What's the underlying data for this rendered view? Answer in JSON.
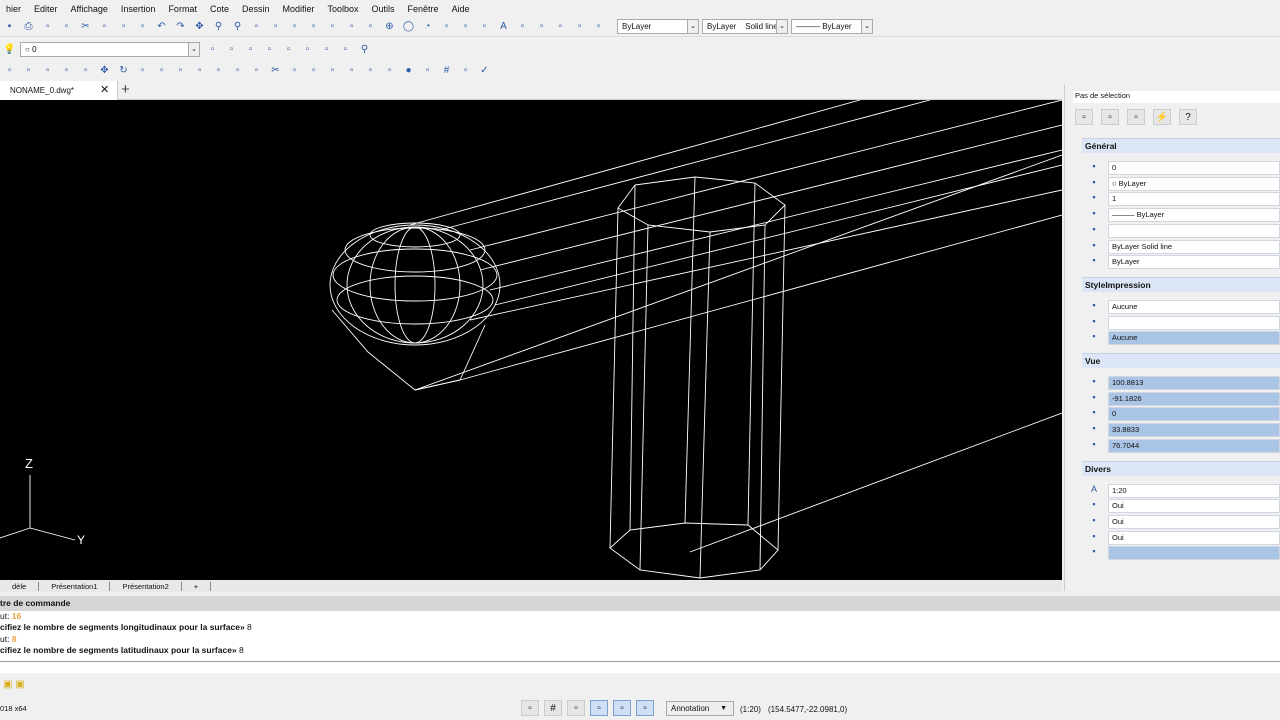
{
  "menu": [
    "hier",
    "Editer",
    "Affichage",
    "Insertion",
    "Format",
    "Cote",
    "Dessin",
    "Modifier",
    "Toolbox",
    "Outils",
    "Fenêtre",
    "Aide"
  ],
  "toolbar1": {
    "icons": [
      "save-icon",
      "print-icon",
      "print-preview-icon",
      "preview-icon",
      "cut-icon",
      "copy-icon",
      "paste-icon",
      "match-properties-icon",
      "undo-icon",
      "redo-icon",
      "pan-icon",
      "zoom-realtime-icon",
      "zoom-window-icon",
      "color-icon",
      "view-icon",
      "iso-view-icon",
      "top-view-icon",
      "front-view-icon",
      "side-view-icon",
      "rotate-view-icon",
      "circle-center-icon",
      "circle-icon",
      "arc-icon",
      "polyline-icon",
      "spline-icon",
      "curve-icon",
      "text-icon",
      "block-icon",
      "insert-icon",
      "layer-icon",
      "properties-icon",
      "pen-icon"
    ],
    "color_combo": "ByLayer",
    "linetype_combo": "ByLayer    Solid line",
    "lineweight_combo": "——— ByLayer"
  },
  "toolbar2": {
    "layer_combo": "0",
    "icons": [
      "layer-state-icon",
      "brush-icon",
      "box-iso-icon",
      "box-front-icon",
      "box-back-icon",
      "box-left-icon",
      "box-right-icon",
      "box-top-icon",
      "zoom-icon"
    ]
  },
  "toolbar3": {
    "icons": [
      "scale-icon",
      "mirror-icon",
      "stretch-icon",
      "offset-icon",
      "array-icon",
      "move-icon",
      "rotate-icon",
      "align-icon",
      "copy-icon",
      "fillet-icon",
      "chamfer-icon",
      "break-icon",
      "join-icon",
      "lengthen-icon",
      "trim-icon",
      "explode-icon",
      "extend-icon",
      "measure-icon",
      "hatch-icon",
      "region-icon",
      "boolean-icon",
      "bomb-icon",
      "spherical-icon",
      "grid-icon",
      "matrix-icon",
      "check-icon"
    ]
  },
  "document_tab": {
    "label": "NONAME_0.dwg*"
  },
  "viewport": {
    "axis_z": "Z",
    "axis_y": "Y"
  },
  "layout_tabs": [
    "dèle",
    "Présentation1",
    "Présentation2",
    "+"
  ],
  "properties": {
    "selection": "Pas de sélection",
    "toolbar_icons": [
      "quick-select-icon",
      "select-objects-icon",
      "toggle-pickadd-icon",
      "lightning-icon",
      "help-icon"
    ],
    "sections": [
      {
        "title": "Général",
        "rows": [
          {
            "icon": "layer-icon",
            "value": "0"
          },
          {
            "icon": "color-icon",
            "value": "○ ByLayer"
          },
          {
            "icon": "linetype-scale-icon",
            "value": "1"
          },
          {
            "icon": "lineweight-icon",
            "value": "——— ByLayer"
          },
          {
            "icon": "hyperlink-icon",
            "value": ""
          },
          {
            "icon": "linetype-icon",
            "value": "ByLayer     Solid line"
          },
          {
            "icon": "transparency-icon",
            "value": "ByLayer"
          }
        ]
      },
      {
        "title": "StyleImpression",
        "rows": [
          {
            "icon": "plot-style-icon",
            "value": "Aucune"
          },
          {
            "icon": "plot-table-icon",
            "value": ""
          },
          {
            "icon": "plot-attached-icon",
            "value": "Aucune",
            "hl": true
          }
        ]
      },
      {
        "title": "Vue",
        "rows": [
          {
            "icon": "center-x-icon",
            "value": "100.8813",
            "hl": true
          },
          {
            "icon": "center-y-icon",
            "value": "-91.1826",
            "hl": true
          },
          {
            "icon": "center-z-icon",
            "value": "0",
            "hl": true
          },
          {
            "icon": "height-icon",
            "value": "33.8833",
            "hl": true
          },
          {
            "icon": "width-icon",
            "value": "76.7044",
            "hl": true
          }
        ]
      },
      {
        "title": "Divers",
        "rows": [
          {
            "icon": "annotation-scale-icon",
            "value": "1:20"
          },
          {
            "icon": "ucs-icon-on",
            "value": "Oui"
          },
          {
            "icon": "ucs-origin-icon",
            "value": "Oui"
          },
          {
            "icon": "ucs-per-viewport-icon",
            "value": "Oui"
          },
          {
            "icon": "ucs-name-icon",
            "value": "",
            "hl": true
          }
        ]
      }
    ]
  },
  "command": {
    "title": "tre de commande",
    "lines": [
      {
        "prefix": "ut: ",
        "value": "16"
      },
      {
        "text": "cifiez le nombre de segments longitudinaux pour la surface» ",
        "value": "8"
      },
      {
        "prefix": "ut: ",
        "value": "8"
      },
      {
        "text": "cifiez le nombre de segments latitudinaux pour la surface» ",
        "value": "8"
      }
    ]
  },
  "status": {
    "version": "018 x64",
    "annotation": "Annotation",
    "scale": "(1:20)",
    "coords": "(154.5477,-22.0981,0)",
    "buttons": [
      "snap-icon",
      "grid-icon",
      "ortho-icon",
      "polar-icon",
      "osnap-icon",
      "lineweight-icon"
    ]
  },
  "colors": {
    "viewport": "#000000",
    "wire": "#ffffff",
    "highlight": "#a9c4e4",
    "accent_orange": "#e8a040"
  }
}
